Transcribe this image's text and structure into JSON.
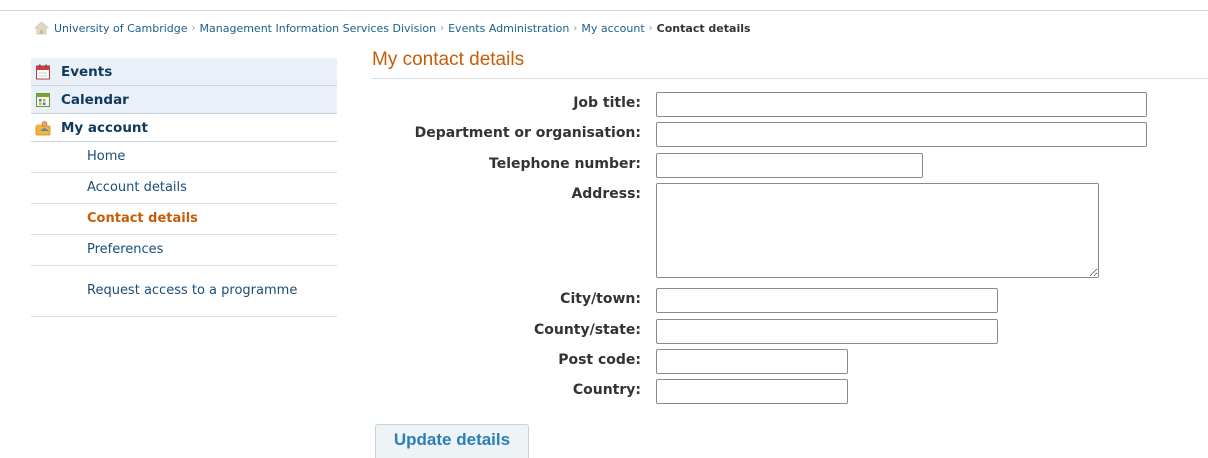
{
  "breadcrumb": {
    "items": [
      "University of Cambridge",
      "Management Information Services Division",
      "Events Administration",
      "My account"
    ],
    "current": "Contact details",
    "separator": "›"
  },
  "sidebar": {
    "events_label": "Events",
    "calendar_label": "Calendar",
    "myaccount_label": "My account",
    "sub_items": [
      {
        "label": "Home"
      },
      {
        "label": "Account details"
      },
      {
        "label": "Contact details"
      },
      {
        "label": "Preferences"
      },
      {
        "label": "Request access to a programme"
      }
    ],
    "icons": {
      "events": "calendar-page-icon",
      "calendar": "calendar-grid-icon",
      "myaccount": "user-folder-icon",
      "home": "house-icon"
    }
  },
  "main": {
    "title": "My contact details",
    "fields": {
      "job_title": {
        "label": "Job title:",
        "value": ""
      },
      "department": {
        "label": "Department or organisation:",
        "value": ""
      },
      "telephone": {
        "label": "Telephone number:",
        "value": ""
      },
      "address": {
        "label": "Address:",
        "value": ""
      },
      "city": {
        "label": "City/town:",
        "value": ""
      },
      "county": {
        "label": "County/state:",
        "value": ""
      },
      "postcode": {
        "label": "Post code:",
        "value": ""
      },
      "country": {
        "label": "Country:",
        "value": ""
      }
    },
    "submit_label": "Update details"
  },
  "colors": {
    "accent_orange": "#c65d07",
    "link_blue": "#1d5f8a",
    "button_text": "#2a7fb8",
    "sidebar_head_bg": "#e9f0f8"
  }
}
